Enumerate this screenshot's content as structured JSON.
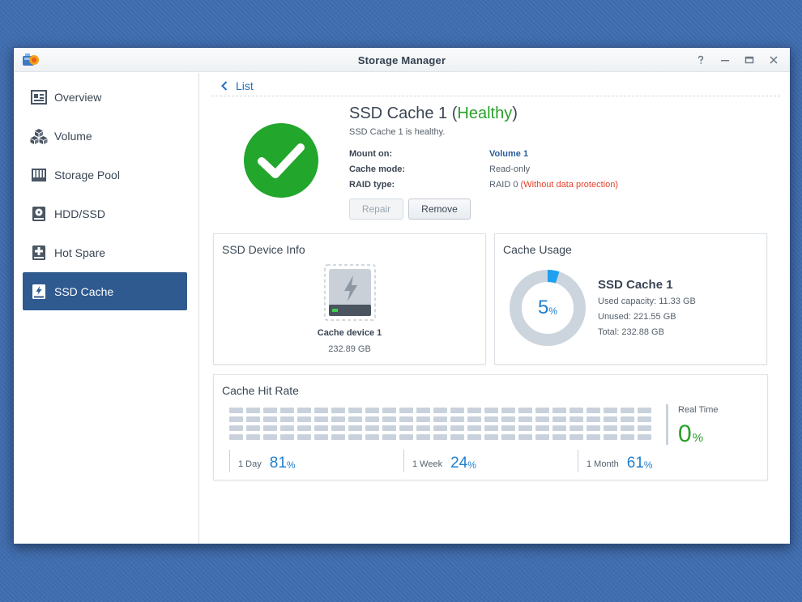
{
  "window": {
    "title": "Storage Manager",
    "controls": [
      "help-icon",
      "minimize-icon",
      "maximize-icon",
      "close-icon"
    ]
  },
  "sidebar": {
    "items": [
      {
        "label": "Overview",
        "icon": "overview-icon"
      },
      {
        "label": "Volume",
        "icon": "volume-icon"
      },
      {
        "label": "Storage Pool",
        "icon": "storage-pool-icon"
      },
      {
        "label": "HDD/SSD",
        "icon": "hdd-icon"
      },
      {
        "label": "Hot Spare",
        "icon": "hot-spare-icon"
      },
      {
        "label": "SSD Cache",
        "icon": "ssd-cache-icon",
        "active": true
      }
    ]
  },
  "header": {
    "back_label": "List",
    "title_prefix": "SSD Cache 1",
    "title_open": "(",
    "title_status": "Healthy",
    "title_close": ")",
    "subtitle": "SSD Cache 1 is healthy.",
    "properties": [
      {
        "label": "Mount on:",
        "value": "Volume 1"
      },
      {
        "label": "Cache mode:",
        "value": "Read-only"
      },
      {
        "label": "RAID type:",
        "value": "RAID 0",
        "warning": "(Without data protection)"
      }
    ],
    "repair_label": "Repair",
    "remove_label": "Remove"
  },
  "device_info": {
    "title": "SSD Device Info",
    "device_name": "Cache device 1",
    "device_size": "232.89 GB"
  },
  "cache_usage": {
    "title": "Cache Usage",
    "percent": 5,
    "percent_text": "5",
    "percent_sign": "%",
    "name": "SSD Cache 1",
    "used": "Used capacity: 11.33 GB",
    "unused": "Unused: 221.55 GB",
    "total": "Total: 232.88 GB"
  },
  "hit_rate": {
    "title": "Cache Hit Rate",
    "realtime_label": "Real Time",
    "realtime_value": "0",
    "percent_sign": "%",
    "stats": [
      {
        "label": "1 Day",
        "value": "81"
      },
      {
        "label": "1 Week",
        "value": "24"
      },
      {
        "label": "1 Month",
        "value": "61"
      }
    ]
  },
  "colors": {
    "accent": "#2f5a8f",
    "healthy": "#2aa02a",
    "link": "#2471c0",
    "warning": "#e2412b",
    "gauge": "#1fa0f0"
  }
}
